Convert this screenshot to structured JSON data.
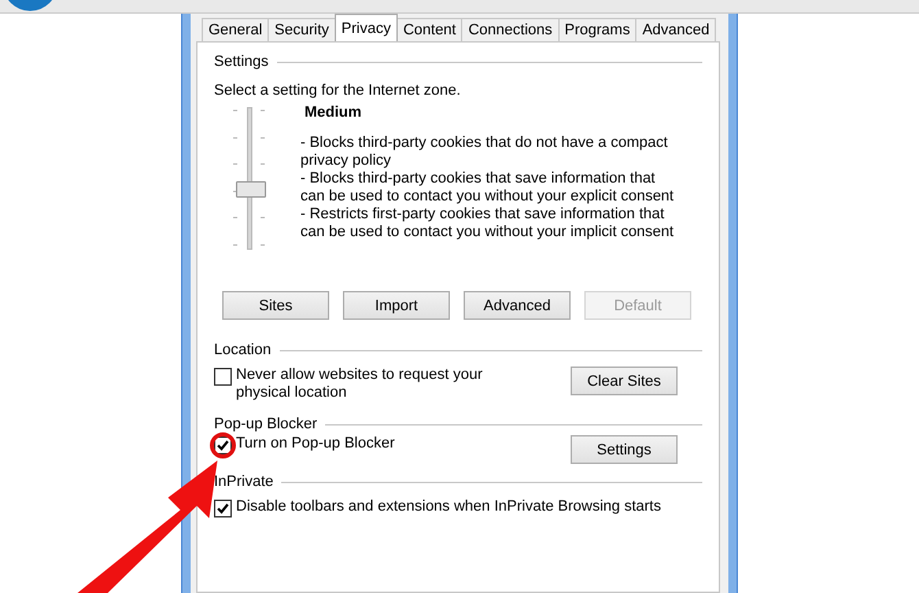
{
  "tabs": [
    {
      "label": "General",
      "selected": false
    },
    {
      "label": "Security",
      "selected": false
    },
    {
      "label": "Privacy",
      "selected": true
    },
    {
      "label": "Content",
      "selected": false
    },
    {
      "label": "Connections",
      "selected": false
    },
    {
      "label": "Programs",
      "selected": false
    },
    {
      "label": "Advanced",
      "selected": false
    }
  ],
  "settings": {
    "heading": "Settings",
    "prompt": "Select a setting for the Internet zone.",
    "slider": {
      "level": 0.4
    },
    "level_name": "Medium",
    "description": [
      "- Blocks third-party cookies that do not have a compact privacy policy",
      "- Blocks third-party cookies that save information that can be used to contact you without your explicit consent",
      "- Restricts first-party cookies that save information that can be used to contact you without your implicit consent"
    ],
    "buttons": [
      {
        "label": "Sites",
        "disabled": false
      },
      {
        "label": "Import",
        "disabled": false
      },
      {
        "label": "Advanced",
        "disabled": false
      },
      {
        "label": "Default",
        "disabled": true
      }
    ]
  },
  "location": {
    "heading": "Location",
    "checkbox": {
      "label": "Never allow websites to request your physical location",
      "checked": false
    },
    "button": "Clear Sites"
  },
  "popup_blocker": {
    "heading": "Pop-up Blocker",
    "checkbox": {
      "label": "Turn on Pop-up Blocker",
      "checked": true
    },
    "button": "Settings"
  },
  "inprivate": {
    "heading": "InPrivate",
    "checkbox": {
      "label": "Disable toolbars and extensions when InPrivate Browsing starts",
      "checked": true
    }
  },
  "highlight": {
    "circle": true,
    "arrow": true
  }
}
